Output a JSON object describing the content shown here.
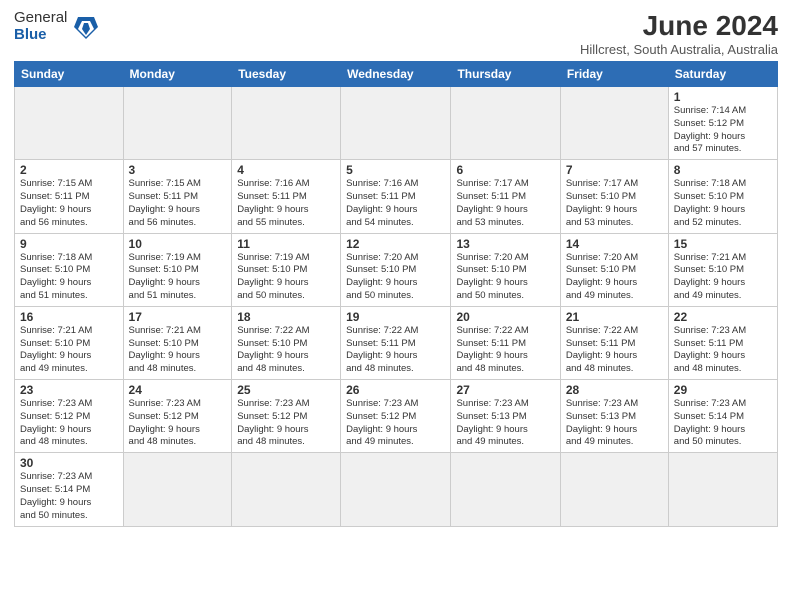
{
  "header": {
    "logo_general": "General",
    "logo_blue": "Blue",
    "month_title": "June 2024",
    "subtitle": "Hillcrest, South Australia, Australia"
  },
  "days_of_week": [
    "Sunday",
    "Monday",
    "Tuesday",
    "Wednesday",
    "Thursday",
    "Friday",
    "Saturday"
  ],
  "weeks": [
    [
      {
        "day": "",
        "info": ""
      },
      {
        "day": "",
        "info": ""
      },
      {
        "day": "",
        "info": ""
      },
      {
        "day": "",
        "info": ""
      },
      {
        "day": "",
        "info": ""
      },
      {
        "day": "",
        "info": ""
      },
      {
        "day": "1",
        "info": "Sunrise: 7:14 AM\nSunset: 5:12 PM\nDaylight: 9 hours\nand 57 minutes."
      }
    ],
    [
      {
        "day": "2",
        "info": "Sunrise: 7:15 AM\nSunset: 5:11 PM\nDaylight: 9 hours\nand 56 minutes."
      },
      {
        "day": "3",
        "info": "Sunrise: 7:15 AM\nSunset: 5:11 PM\nDaylight: 9 hours\nand 56 minutes."
      },
      {
        "day": "4",
        "info": "Sunrise: 7:16 AM\nSunset: 5:11 PM\nDaylight: 9 hours\nand 55 minutes."
      },
      {
        "day": "5",
        "info": "Sunrise: 7:16 AM\nSunset: 5:11 PM\nDaylight: 9 hours\nand 54 minutes."
      },
      {
        "day": "6",
        "info": "Sunrise: 7:17 AM\nSunset: 5:11 PM\nDaylight: 9 hours\nand 53 minutes."
      },
      {
        "day": "7",
        "info": "Sunrise: 7:17 AM\nSunset: 5:10 PM\nDaylight: 9 hours\nand 53 minutes."
      },
      {
        "day": "8",
        "info": "Sunrise: 7:18 AM\nSunset: 5:10 PM\nDaylight: 9 hours\nand 52 minutes."
      }
    ],
    [
      {
        "day": "9",
        "info": "Sunrise: 7:18 AM\nSunset: 5:10 PM\nDaylight: 9 hours\nand 51 minutes."
      },
      {
        "day": "10",
        "info": "Sunrise: 7:19 AM\nSunset: 5:10 PM\nDaylight: 9 hours\nand 51 minutes."
      },
      {
        "day": "11",
        "info": "Sunrise: 7:19 AM\nSunset: 5:10 PM\nDaylight: 9 hours\nand 50 minutes."
      },
      {
        "day": "12",
        "info": "Sunrise: 7:20 AM\nSunset: 5:10 PM\nDaylight: 9 hours\nand 50 minutes."
      },
      {
        "day": "13",
        "info": "Sunrise: 7:20 AM\nSunset: 5:10 PM\nDaylight: 9 hours\nand 50 minutes."
      },
      {
        "day": "14",
        "info": "Sunrise: 7:20 AM\nSunset: 5:10 PM\nDaylight: 9 hours\nand 49 minutes."
      },
      {
        "day": "15",
        "info": "Sunrise: 7:21 AM\nSunset: 5:10 PM\nDaylight: 9 hours\nand 49 minutes."
      }
    ],
    [
      {
        "day": "16",
        "info": "Sunrise: 7:21 AM\nSunset: 5:10 PM\nDaylight: 9 hours\nand 49 minutes."
      },
      {
        "day": "17",
        "info": "Sunrise: 7:21 AM\nSunset: 5:10 PM\nDaylight: 9 hours\nand 48 minutes."
      },
      {
        "day": "18",
        "info": "Sunrise: 7:22 AM\nSunset: 5:10 PM\nDaylight: 9 hours\nand 48 minutes."
      },
      {
        "day": "19",
        "info": "Sunrise: 7:22 AM\nSunset: 5:11 PM\nDaylight: 9 hours\nand 48 minutes."
      },
      {
        "day": "20",
        "info": "Sunrise: 7:22 AM\nSunset: 5:11 PM\nDaylight: 9 hours\nand 48 minutes."
      },
      {
        "day": "21",
        "info": "Sunrise: 7:22 AM\nSunset: 5:11 PM\nDaylight: 9 hours\nand 48 minutes."
      },
      {
        "day": "22",
        "info": "Sunrise: 7:23 AM\nSunset: 5:11 PM\nDaylight: 9 hours\nand 48 minutes."
      }
    ],
    [
      {
        "day": "23",
        "info": "Sunrise: 7:23 AM\nSunset: 5:12 PM\nDaylight: 9 hours\nand 48 minutes."
      },
      {
        "day": "24",
        "info": "Sunrise: 7:23 AM\nSunset: 5:12 PM\nDaylight: 9 hours\nand 48 minutes."
      },
      {
        "day": "25",
        "info": "Sunrise: 7:23 AM\nSunset: 5:12 PM\nDaylight: 9 hours\nand 48 minutes."
      },
      {
        "day": "26",
        "info": "Sunrise: 7:23 AM\nSunset: 5:12 PM\nDaylight: 9 hours\nand 49 minutes."
      },
      {
        "day": "27",
        "info": "Sunrise: 7:23 AM\nSunset: 5:13 PM\nDaylight: 9 hours\nand 49 minutes."
      },
      {
        "day": "28",
        "info": "Sunrise: 7:23 AM\nSunset: 5:13 PM\nDaylight: 9 hours\nand 49 minutes."
      },
      {
        "day": "29",
        "info": "Sunrise: 7:23 AM\nSunset: 5:14 PM\nDaylight: 9 hours\nand 50 minutes."
      }
    ],
    [
      {
        "day": "30",
        "info": "Sunrise: 7:23 AM\nSunset: 5:14 PM\nDaylight: 9 hours\nand 50 minutes."
      },
      {
        "day": "",
        "info": ""
      },
      {
        "day": "",
        "info": ""
      },
      {
        "day": "",
        "info": ""
      },
      {
        "day": "",
        "info": ""
      },
      {
        "day": "",
        "info": ""
      },
      {
        "day": "",
        "info": ""
      }
    ]
  ]
}
